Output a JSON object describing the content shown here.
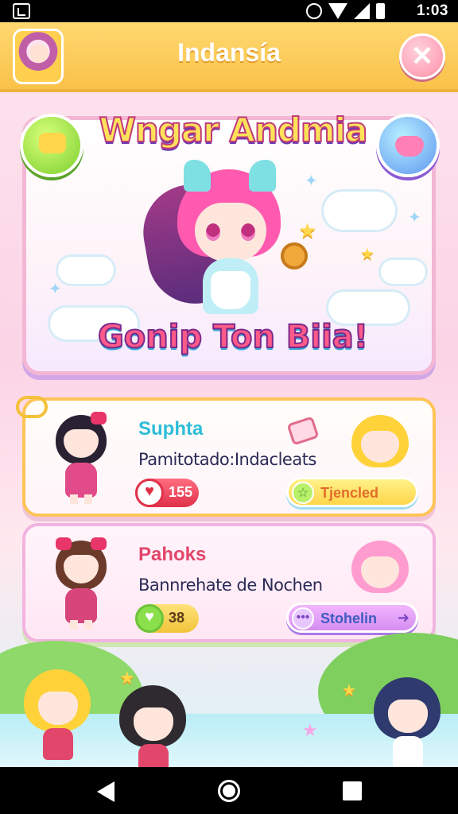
{
  "status_bar": {
    "time": "1:03"
  },
  "header": {
    "title": "Indansía"
  },
  "hero": {
    "title": "Wngar Andmia",
    "subtitle": "Gonip Ton Biia!"
  },
  "cards": [
    {
      "name": "Suphta",
      "description": "Pamitotado:Indacleats",
      "stat_value": "155",
      "action_label": "Tjencled"
    },
    {
      "name": "Pahoks",
      "description": "Bannrehate de Nochen",
      "stat_value": "38",
      "action_label": "Stohelin"
    }
  ],
  "colors": {
    "header_bg": "#f9c24a",
    "hero_border": "#f3b6d4",
    "card1_name": "#2dbdd8",
    "card2_name": "#e2466a",
    "card_border": "#ffc457"
  },
  "icons": {
    "close": "close-icon",
    "heart": "heart-icon",
    "star": "star-icon",
    "arrow": "arrow-right-icon",
    "back": "back-icon",
    "home": "home-icon",
    "recents": "recents-icon"
  }
}
